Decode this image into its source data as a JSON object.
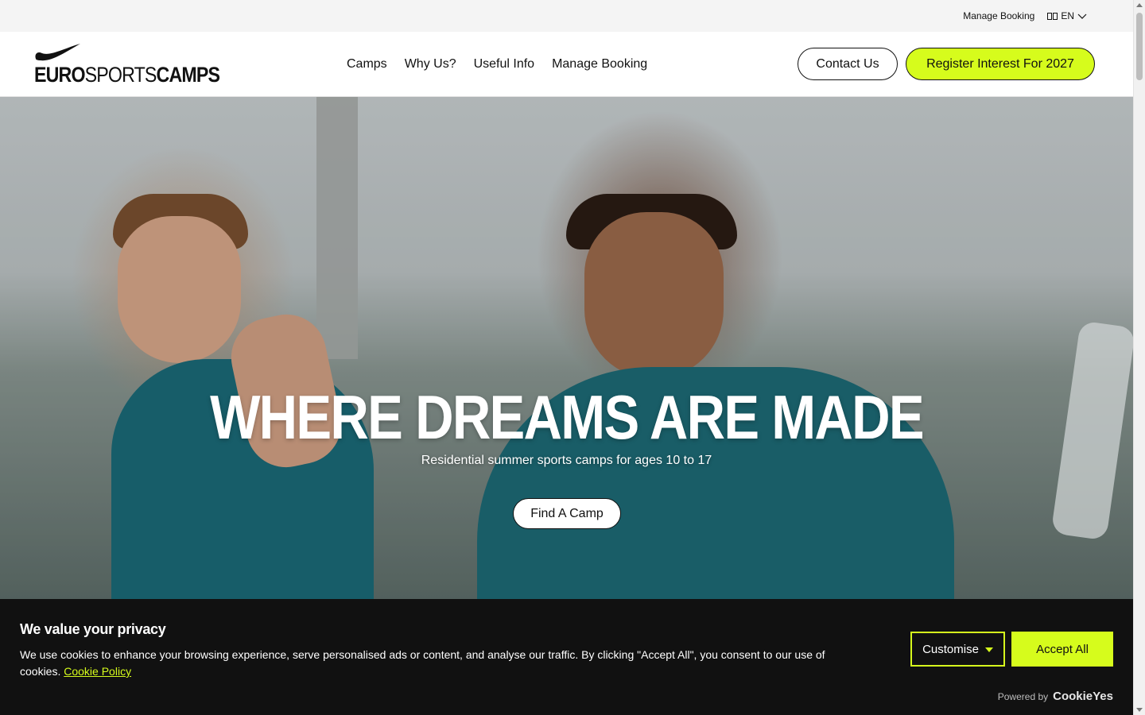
{
  "utility_bar": {
    "manage_booking": "Manage Booking",
    "language": "EN"
  },
  "header": {
    "logo": {
      "part1": "EURO",
      "part2": "SPORTS",
      "part3": "CAMPS",
      "icon": "swoosh-logo"
    },
    "nav": [
      {
        "label": "Camps"
      },
      {
        "label": "Why Us?"
      },
      {
        "label": "Useful Info"
      },
      {
        "label": "Manage Booking"
      }
    ],
    "contact_label": "Contact Us",
    "register_label": "Register Interest For 2027"
  },
  "hero": {
    "title": "WHERE DREAMS ARE MADE",
    "subtitle": "Residential summer sports camps for ages 10 to 17",
    "cta_label": "Find A Camp"
  },
  "cookie_banner": {
    "title": "We value your privacy",
    "text": "We use cookies to enhance your browsing experience, serve personalised ads or content, and analyse our traffic. By clicking \"Accept All\", you consent to our use of cookies.",
    "policy_link": "Cookie Policy",
    "customise_label": "Customise",
    "accept_label": "Accept All",
    "powered_by": "Powered by",
    "powered_brand": "CookieYes"
  },
  "colors": {
    "accent": "#d6fc1c",
    "banner_bg": "#111111",
    "text": "#111111"
  }
}
